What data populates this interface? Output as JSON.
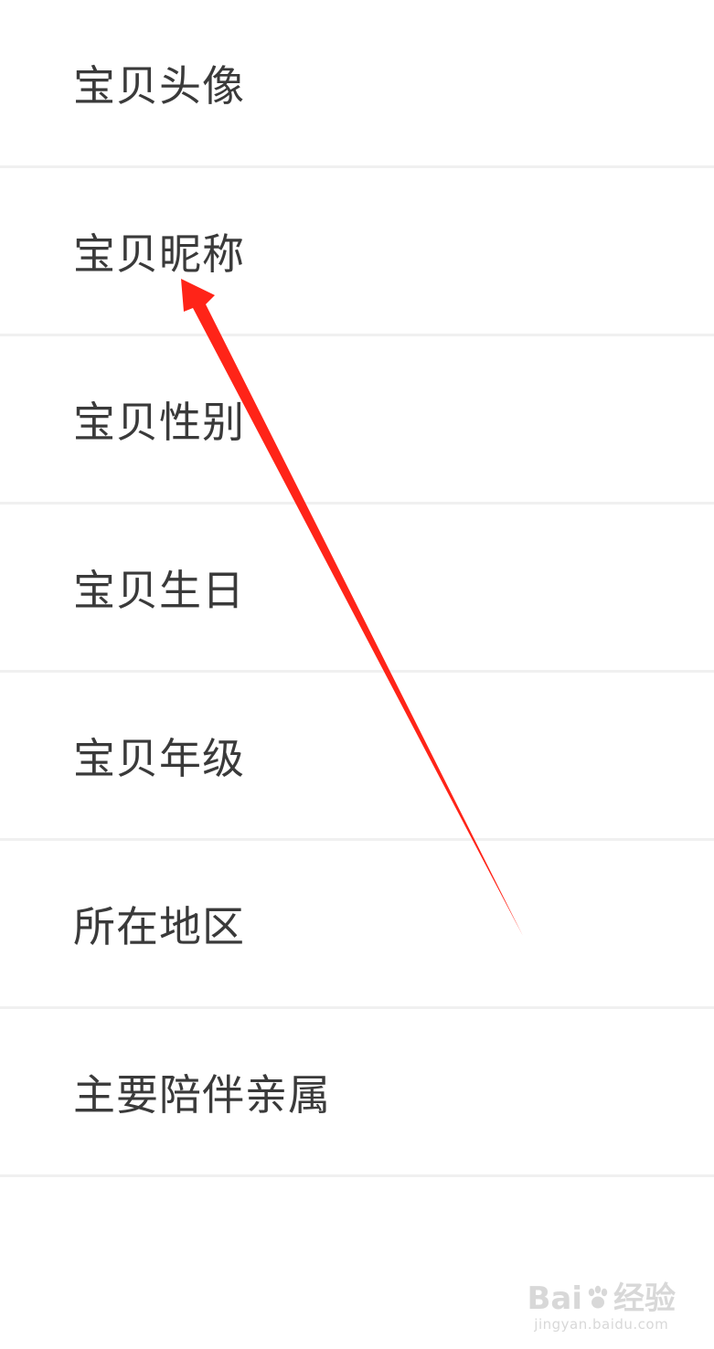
{
  "settings": {
    "items": [
      {
        "label": "宝贝头像"
      },
      {
        "label": "宝贝昵称"
      },
      {
        "label": "宝贝性别"
      },
      {
        "label": "宝贝生日"
      },
      {
        "label": "宝贝年级"
      },
      {
        "label": "所在地区"
      },
      {
        "label": "主要陪伴亲属"
      }
    ]
  },
  "annotation": {
    "arrow_color": "#ff2418",
    "arrow_target": "宝贝昵称"
  },
  "watermark": {
    "brand_left": "Bai",
    "brand_right": "经验",
    "url": "jingyan.baidu.com",
    "icon": "paw-icon"
  }
}
